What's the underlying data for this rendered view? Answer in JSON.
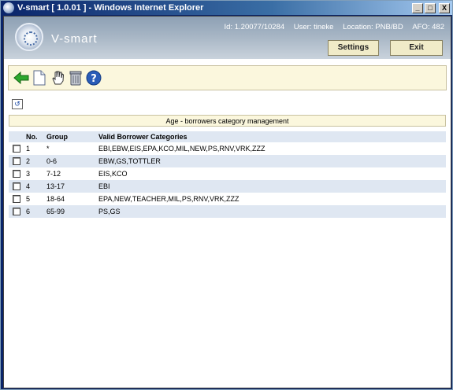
{
  "window": {
    "title": "V-smart [ 1.0.01 ] - Windows Internet Explorer",
    "controls": [
      "_",
      "□",
      "X"
    ]
  },
  "header": {
    "logo_text": "V-smart",
    "id": "Id: 1.20077/10284",
    "user": "User: tineke",
    "location": "Location: PNB/BD",
    "afo": "AFO: 482",
    "settings_label": "Settings",
    "exit_label": "Exit"
  },
  "toolbar": {
    "icons": [
      "back-arrow-icon",
      "new-document-icon",
      "hand-select-icon",
      "trash-icon",
      "help-icon"
    ]
  },
  "undo_glyph": "↺",
  "caption": "Age - borrowers category management",
  "table": {
    "headers": [
      "No.",
      "Group",
      "Valid Borrower Categories"
    ],
    "rows": [
      {
        "no": "1",
        "group": "*",
        "cats": "EBI,EBW,EIS,EPA,KCO,MIL,NEW,PS,RNV,VRK,ZZZ"
      },
      {
        "no": "2",
        "group": "0-6",
        "cats": "EBW,GS,TOTTLER"
      },
      {
        "no": "3",
        "group": "7-12",
        "cats": "EIS,KCO"
      },
      {
        "no": "4",
        "group": "13-17",
        "cats": "EBI"
      },
      {
        "no": "5",
        "group": "18-64",
        "cats": "EPA,NEW,TEACHER,MIL,PS,RNV,VRK,ZZZ"
      },
      {
        "no": "6",
        "group": "65-99",
        "cats": "PS,GS"
      }
    ]
  },
  "colors": {
    "title_bar": "#0a246a",
    "header_band": "#a9b7c6",
    "toolbar_bg": "#fbf7dd",
    "row_alt": "#dfe7f2"
  }
}
